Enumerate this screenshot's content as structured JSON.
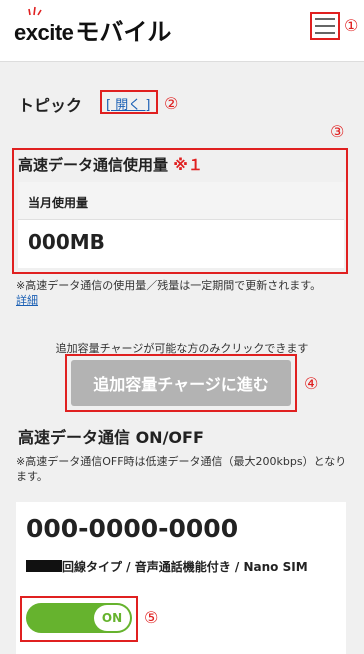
{
  "header": {
    "logo_text_latin": "excite",
    "logo_text_kana": "モバイル",
    "callout_1": "①"
  },
  "topic": {
    "title": "トピック",
    "link": "[ 開く ]",
    "callout": "②"
  },
  "usage": {
    "callout": "③",
    "title": "高速データ通信使用量",
    "note_mark": "※１",
    "month_label": "当月使用量",
    "month_value": "000MB",
    "footnote": "※高速データ通信の使用量／残量は一定期間で更新されます。",
    "detail_link": "詳細"
  },
  "charge": {
    "note": "追加容量チャージが可能な方のみクリックできます",
    "button": "追加容量チャージに進む",
    "callout": "④"
  },
  "high_speed": {
    "title": "高速データ通信 ON/OFF",
    "note": "※高速データ通信OFF時は低速データ通信（最大200kbps）となります。"
  },
  "line": {
    "number": "000-0000-0000",
    "type": "回線タイプ / 音声通話機能付き / Nano SIM",
    "toggle_label": "ON",
    "toggle_on": true,
    "callout": "⑤"
  },
  "colors": {
    "accent": "#e02020",
    "link": "#1a5fb4",
    "toggle_green": "#66b32e",
    "disabled_button": "#b3b3b3"
  }
}
